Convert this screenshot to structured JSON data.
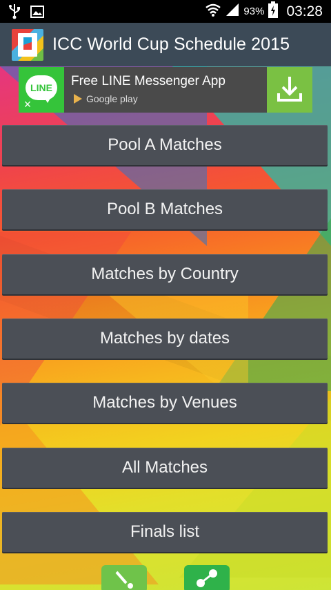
{
  "status_bar": {
    "battery_percent": "93%",
    "time": "03:28"
  },
  "app": {
    "title": "ICC World Cup Schedule 2015"
  },
  "ad": {
    "logo_text": "LINE",
    "headline": "Free LINE Messenger App",
    "store": "Google play",
    "close_symbol": "×"
  },
  "menu": [
    {
      "label": "Pool A Matches"
    },
    {
      "label": "Pool B Matches"
    },
    {
      "label": "Matches by Country"
    },
    {
      "label": "Matches by dates"
    },
    {
      "label": "Matches by Venues"
    },
    {
      "label": "All Matches"
    },
    {
      "label": "Finals list"
    }
  ],
  "icons": {
    "usb": "usb-icon",
    "image": "image-icon",
    "wifi": "wifi-icon",
    "signal": "signal-icon",
    "battery": "battery-icon",
    "download": "download-icon",
    "cricket": "cricket-icon",
    "share": "share-icon"
  }
}
